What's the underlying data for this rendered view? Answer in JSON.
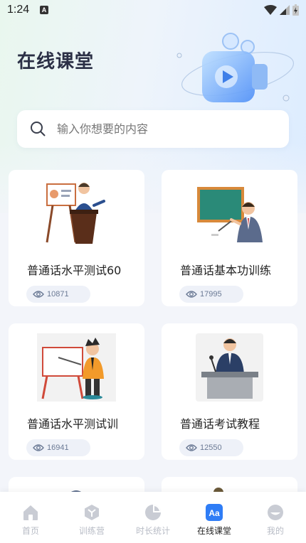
{
  "status": {
    "time": "1:24",
    "notif": "A"
  },
  "header": {
    "title": "在线课堂"
  },
  "search": {
    "placeholder": "输入你想要的内容"
  },
  "courses": [
    {
      "title": "普通话水平测试60",
      "views": "10871"
    },
    {
      "title": "普通话基本功训练",
      "views": "17995"
    },
    {
      "title": "普通话水平测试训",
      "views": "16941"
    },
    {
      "title": "普通话考试教程",
      "views": "12550"
    }
  ],
  "nav": [
    {
      "label": "首页",
      "icon": "home-icon",
      "active": false
    },
    {
      "label": "训练营",
      "icon": "cube-icon",
      "active": false
    },
    {
      "label": "时长统计",
      "icon": "pie-chart-icon",
      "active": false
    },
    {
      "label": "在线课堂",
      "icon": "classroom-icon",
      "active": true
    },
    {
      "label": "我的",
      "icon": "profile-icon",
      "active": false
    }
  ],
  "colors": {
    "accent": "#2f7df6",
    "inactive": "#c9ccd4",
    "title": "#2b3046"
  }
}
